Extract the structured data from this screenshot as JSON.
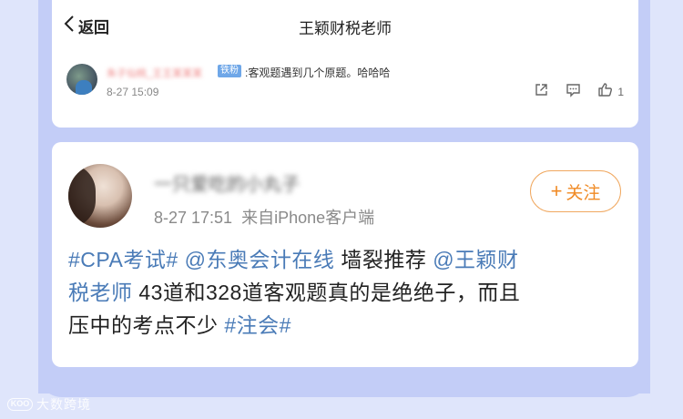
{
  "nav": {
    "back_label": "返回",
    "title": "王颖财税老师"
  },
  "comment": {
    "username": "朱子仙桃_王王某某某",
    "badge": "铁粉",
    "text": ":客观题遇到几个原题。哈哈哈",
    "time": "8-27 15:09",
    "like_count": "1",
    "icons": [
      "share-icon",
      "comment-icon",
      "like-icon"
    ]
  },
  "post": {
    "username": "一只爱吃的小丸子",
    "date": "8-27 17:51",
    "source": "来自iPhone客户端",
    "follow_plus": "+",
    "follow_label": "关注",
    "content": {
      "tag1": "#CPA考试#",
      "mention1": "@东奥会计在线",
      "text1": "墙裂推荐",
      "mention2a": "@王颖财",
      "mention2b": "税老师",
      "text2": "43道和328道客观题真的是绝绝子，而且",
      "text3": "压中的考点不少",
      "tag2": "#注会#"
    }
  },
  "watermark": {
    "logo": "KOO",
    "text": "大数跨境"
  },
  "colors": {
    "background": "#c3cdf7",
    "frame": "#dfe5fb",
    "tag_blue": "#4a7bb7",
    "follow_orange": "#f08a24",
    "badge_blue": "#6fa7e8"
  }
}
